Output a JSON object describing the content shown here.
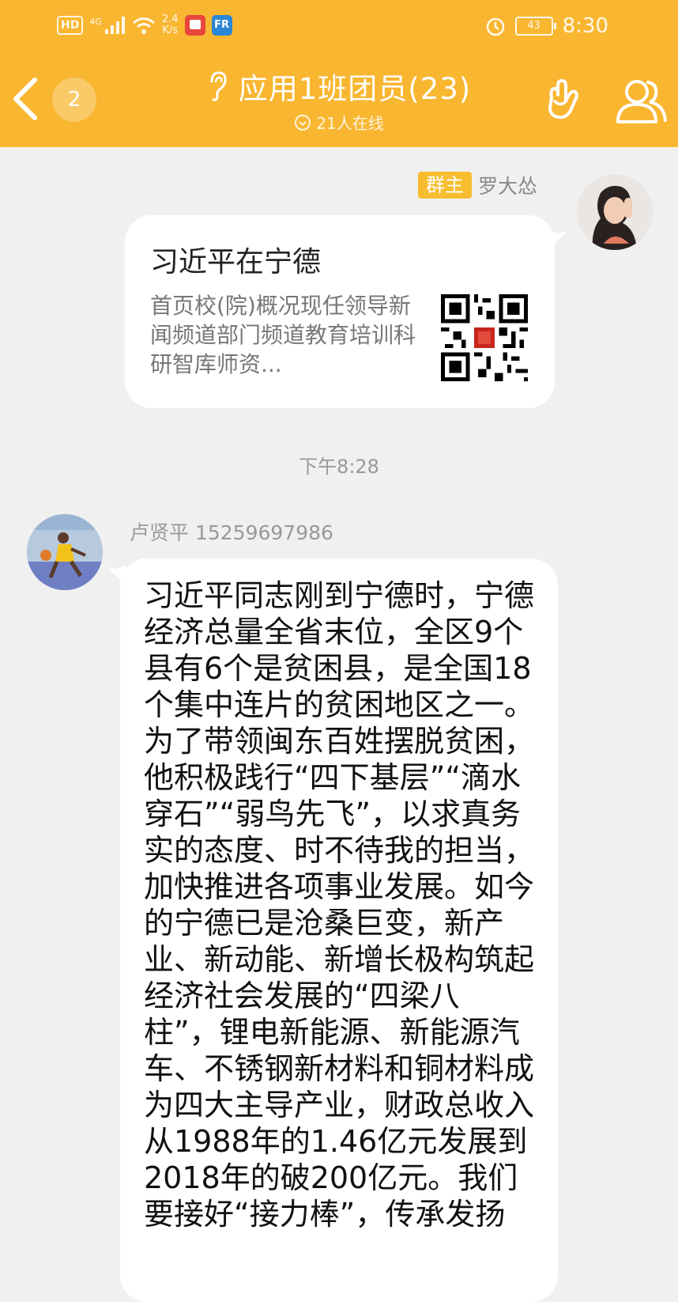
{
  "status_bar": {
    "hd": "HD",
    "network": "4G",
    "speed_value": "2.4",
    "speed_unit": "K/s",
    "app2": "FR",
    "battery": "43",
    "time": "8:30"
  },
  "header": {
    "unread_count": "2",
    "title": "应用1班团员(23)",
    "online": "21人在线"
  },
  "messages": [
    {
      "badge": "群主",
      "sender": "罗大怂",
      "card_title": "习近平在宁德",
      "card_desc": "首页校(院)概况现任领导新闻频道部门频道教育培训科研智库师资..."
    },
    {
      "sender": "卢贤平 15259697986",
      "text": "习近平同志刚到宁德时，宁德经济总量全省末位，全区9个县有6个是贫困县，是全国18个集中连片的贫困地区之一。为了带领闽东百姓摆脱贫困，他积极践行“四下基层”“滴水穿石”“弱鸟先飞”，以求真务实的态度、时不待我的担当，加快推进各项事业发展。如今的宁德已是沧桑巨变，新产业、新动能、新增长极构筑起经济社会发展的“四梁八柱”，锂电新能源、新能源汽车、不锈钢新材料和铜材料成为四大主导产业，财政总收入从1988年的1.46亿元发展到2018年的破200亿元。我们要接好“接力棒”，传承发扬"
    }
  ],
  "time_divider": "下午8:28",
  "colors": {
    "header_bg": "#f9b630",
    "owner_badge": "#f7bd2f",
    "chat_bg": "#f0f0f0"
  },
  "icons": [
    "back-arrow-icon",
    "ear-icon",
    "online-clock-icon",
    "hand-gesture-icon",
    "group-members-icon",
    "qr-code-icon",
    "alarm-icon",
    "wifi-icon",
    "signal-icon"
  ]
}
